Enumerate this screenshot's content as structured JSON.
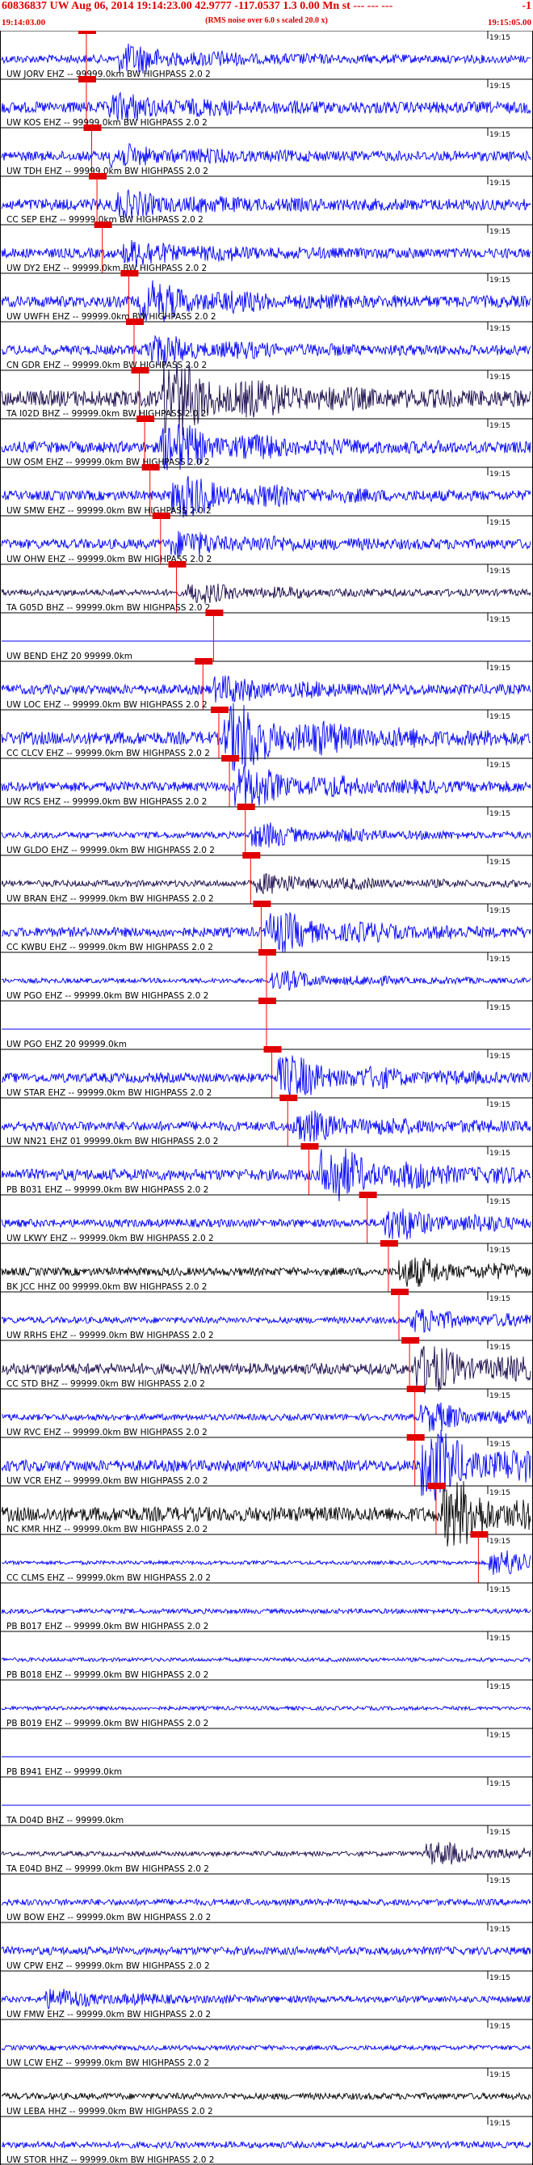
{
  "header": {
    "title": "60836837 UW Aug 06, 2014 19:14:23.00   42.9777 -117.0537  1.3 0.00 Mn st --- --- ---",
    "right_marker": "-1",
    "rms_note": "(RMS noise over 6.0 s scaled 20.0 x)",
    "start_time": "19:14:03.00",
    "end_time": "19:15:05.00"
  },
  "tick_label": "19:15",
  "colors": {
    "blue": "#0000ff",
    "navy": "#1a0a4a",
    "black": "#000000",
    "red": "#ff0000",
    "pick_box": "#e00000"
  },
  "traces": [
    {
      "label": "UW JORV EHZ -- 99999.0km BW  HIGHPASS  2.0  2",
      "color": "blue",
      "amp": 0.25,
      "pick": 0.16,
      "burst": 0.22,
      "bamp": 0.6
    },
    {
      "label": "UW KOS EHZ -- 99999.0km BW  HIGHPASS  2.0  2",
      "color": "blue",
      "amp": 0.35,
      "pick": 0.16,
      "burst": 0.2,
      "bamp": 0.5
    },
    {
      "label": "UW TDH EHZ -- 99999.0km BW  HIGHPASS  2.0  2",
      "color": "blue",
      "amp": 0.3,
      "pick": 0.17,
      "burst": 0.2,
      "bamp": 0.4
    },
    {
      "label": "CC SEP EHZ -- 99999.0km BW  HIGHPASS  2.0  2",
      "color": "blue",
      "amp": 0.35,
      "pick": 0.18,
      "burst": 0.21,
      "bamp": 0.45
    },
    {
      "label": "UW DY2 EHZ -- 99999.0km BW  HIGHPASS  2.0  2",
      "color": "blue",
      "amp": 0.3,
      "pick": 0.19,
      "burst": 0.23,
      "bamp": 0.5
    },
    {
      "label": "UW UWFH EHZ -- 99999.0km BW  HIGHPASS  2.0  2",
      "color": "blue",
      "amp": 0.35,
      "pick": 0.24,
      "burst": 0.26,
      "bamp": 0.8
    },
    {
      "label": "CN GDR EHZ -- 99999.0km BW  HIGHPASS  2.0  2",
      "color": "blue",
      "amp": 0.3,
      "pick": 0.25,
      "burst": 0.27,
      "bamp": 0.6
    },
    {
      "label": "TA I02D BHZ -- 99999.0km BW  HIGHPASS  2.0  2",
      "color": "navy",
      "amp": 0.5,
      "pick": 0.26,
      "burst": 0.3,
      "bamp": 1.6
    },
    {
      "label": "UW OSM EHZ -- 99999.0km BW  HIGHPASS  2.0  2",
      "color": "blue",
      "amp": 0.35,
      "pick": 0.27,
      "burst": 0.3,
      "bamp": 1.0
    },
    {
      "label": "UW SMW EHZ -- 99999.0km BW  HIGHPASS  2.0  2",
      "color": "blue",
      "amp": 0.3,
      "pick": 0.28,
      "burst": 0.32,
      "bamp": 0.9
    },
    {
      "label": "UW OHW EHZ -- 99999.0km BW  HIGHPASS  2.0  2",
      "color": "blue",
      "amp": 0.3,
      "pick": 0.3,
      "burst": 0.32,
      "bamp": 0.5
    },
    {
      "label": "TA G05D BHZ -- 99999.0km BW  HIGHPASS  2.0  2",
      "color": "navy",
      "amp": 0.2,
      "pick": 0.33,
      "burst": 0.35,
      "bamp": 0.4
    },
    {
      "label": "UW BEND EHZ 20 99999.0km",
      "color": "blue",
      "amp": 0.0,
      "pick": 0.4,
      "burst": 0.4,
      "bamp": 0.0
    },
    {
      "label": "UW LOC EHZ -- 99999.0km BW  HIGHPASS  2.0  2",
      "color": "blue",
      "amp": 0.3,
      "pick": 0.38,
      "burst": 0.4,
      "bamp": 0.5
    },
    {
      "label": "CC CLCV EHZ -- 99999.0km BW  HIGHPASS  2.0  2",
      "color": "blue",
      "amp": 0.4,
      "pick": 0.41,
      "burst": 0.42,
      "bamp": 1.5
    },
    {
      "label": "UW RCS EHZ -- 99999.0km BW  HIGHPASS  2.0  2",
      "color": "blue",
      "amp": 0.3,
      "pick": 0.43,
      "burst": 0.44,
      "bamp": 0.9
    },
    {
      "label": "UW GLDO EHZ -- 99999.0km BW  HIGHPASS  2.0  2",
      "color": "blue",
      "amp": 0.2,
      "pick": 0.46,
      "burst": 0.47,
      "bamp": 0.5
    },
    {
      "label": "UW BRAN EHZ -- 99999.0km BW  HIGHPASS  2.0  2",
      "color": "navy",
      "amp": 0.2,
      "pick": 0.47,
      "burst": 0.48,
      "bamp": 0.4
    },
    {
      "label": "CC KWBU EHZ -- 99999.0km BW  HIGHPASS  2.0  2",
      "color": "blue",
      "amp": 0.3,
      "pick": 0.49,
      "burst": 0.5,
      "bamp": 0.8
    },
    {
      "label": "UW PGO EHZ -- 99999.0km BW  HIGHPASS  2.0  2",
      "color": "blue",
      "amp": 0.15,
      "pick": 0.5,
      "burst": 0.51,
      "bamp": 0.4
    },
    {
      "label": "UW PGO EHZ 20 99999.0km",
      "color": "blue",
      "amp": 0.0,
      "pick": 0.5,
      "burst": 0.5,
      "bamp": 0.0
    },
    {
      "label": "UW STAR EHZ -- 99999.0km BW  HIGHPASS  2.0  2",
      "color": "blue",
      "amp": 0.3,
      "pick": 0.51,
      "burst": 0.52,
      "bamp": 0.9
    },
    {
      "label": "UW NN21 EHZ 01 99999.0km BW  HIGHPASS  2.0  2",
      "color": "blue",
      "amp": 0.3,
      "pick": 0.54,
      "burst": 0.55,
      "bamp": 0.6
    },
    {
      "label": "PB B031 EHZ -- 99999.0km BW  HIGHPASS  2.0  2",
      "color": "blue",
      "amp": 0.35,
      "pick": 0.58,
      "burst": 0.6,
      "bamp": 1.2
    },
    {
      "label": "UW LKWY EHZ -- 99999.0km BW  HIGHPASS  2.0  2",
      "color": "blue",
      "amp": 0.25,
      "pick": 0.69,
      "burst": 0.72,
      "bamp": 0.7
    },
    {
      "label": "BK JCC HHZ 00 99999.0km BW  HIGHPASS  2.0  2",
      "color": "black",
      "amp": 0.25,
      "pick": 0.73,
      "burst": 0.75,
      "bamp": 0.6
    },
    {
      "label": "UW RRHS EHZ -- 99999.0km BW  HIGHPASS  2.0  2",
      "color": "blue",
      "amp": 0.2,
      "pick": 0.75,
      "burst": 0.77,
      "bamp": 0.5
    },
    {
      "label": "CC STD BHZ -- 99999.0km BW  HIGHPASS  2.0  2",
      "color": "navy",
      "amp": 0.35,
      "pick": 0.77,
      "burst": 0.78,
      "bamp": 1.0
    },
    {
      "label": "UW RVC EHZ -- 99999.0km BW  HIGHPASS  2.0  2",
      "color": "blue",
      "amp": 0.2,
      "pick": 0.78,
      "burst": 0.79,
      "bamp": 0.6
    },
    {
      "label": "UW VCR EHZ -- 99999.0km BW  HIGHPASS  2.0  2",
      "color": "blue",
      "amp": 0.35,
      "pick": 0.78,
      "burst": 0.79,
      "bamp": 1.6
    },
    {
      "label": "NC KMR HHZ -- 99999.0km BW  HIGHPASS  2.0  2",
      "color": "black",
      "amp": 0.45,
      "pick": 0.82,
      "burst": 0.83,
      "bamp": 1.4
    },
    {
      "label": "CC CLMS EHZ -- 99999.0km BW  HIGHPASS  2.0  2",
      "color": "blue",
      "amp": 0.12,
      "pick": 0.9,
      "burst": 0.92,
      "bamp": 0.6
    },
    {
      "label": "PB B017 EHZ -- 99999.0km BW  HIGHPASS  2.0  2",
      "color": "blue",
      "amp": 0.15,
      "pick": null,
      "burst": 1.1,
      "bamp": 0.0
    },
    {
      "label": "PB B018 EHZ -- 99999.0km BW  HIGHPASS  2.0  2",
      "color": "blue",
      "amp": 0.12,
      "pick": null,
      "burst": 1.1,
      "bamp": 0.0
    },
    {
      "label": "PB B019 EHZ -- 99999.0km BW  HIGHPASS  2.0  2",
      "color": "blue",
      "amp": 0.12,
      "pick": null,
      "burst": 1.1,
      "bamp": 0.0
    },
    {
      "label": "PB B941 EHZ -- 99999.0km",
      "color": "blue",
      "amp": 0.0,
      "pick": null,
      "burst": 1.1,
      "bamp": 0.0
    },
    {
      "label": "TA D04D BHZ -- 99999.0km",
      "color": "blue",
      "amp": 0.0,
      "pick": null,
      "burst": 1.1,
      "bamp": 0.0
    },
    {
      "label": "TA E04D BHZ -- 99999.0km BW  HIGHPASS  2.0  2",
      "color": "navy",
      "amp": 0.15,
      "pick": null,
      "burst": 0.8,
      "bamp": 0.5
    },
    {
      "label": "UW BOW EHZ -- 99999.0km BW  HIGHPASS  2.0  2",
      "color": "blue",
      "amp": 0.2,
      "pick": null,
      "burst": 1.1,
      "bamp": 0.0
    },
    {
      "label": "UW CPW EHZ -- 99999.0km BW  HIGHPASS  2.0  2",
      "color": "blue",
      "amp": 0.25,
      "pick": null,
      "burst": 1.1,
      "bamp": 0.0
    },
    {
      "label": "UW FMW EHZ -- 99999.0km BW  HIGHPASS  2.0  2",
      "color": "blue",
      "amp": 0.2,
      "pick": null,
      "burst": 0.08,
      "bamp": 0.4
    },
    {
      "label": "UW LCW EHZ -- 99999.0km BW  HIGHPASS  2.0  2",
      "color": "blue",
      "amp": 0.15,
      "pick": null,
      "burst": 1.1,
      "bamp": 0.0
    },
    {
      "label": "UW LEBA HHZ -- 99999.0km BW  HIGHPASS  2.0  2",
      "color": "black",
      "amp": 0.2,
      "pick": null,
      "burst": 1.1,
      "bamp": 0.0
    },
    {
      "label": "UW STOR HHZ -- 99999.0km BW  HIGHPASS  2.0  2",
      "color": "blue",
      "amp": 0.2,
      "pick": null,
      "burst": 1.1,
      "bamp": 0.0
    }
  ]
}
